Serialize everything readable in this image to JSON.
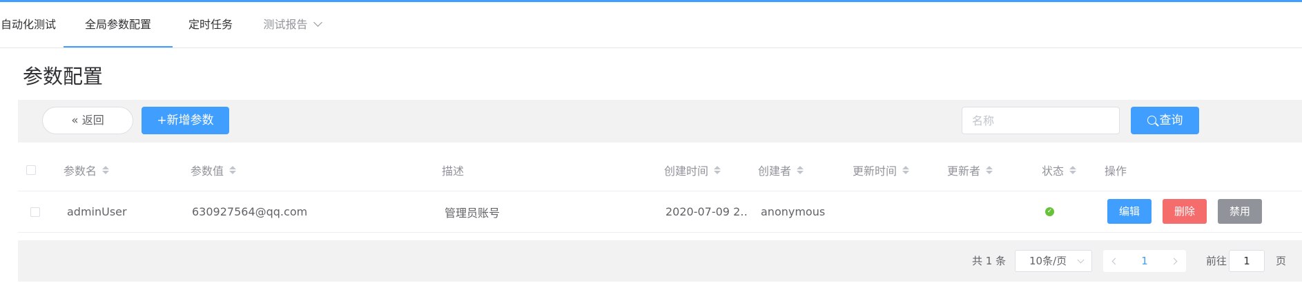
{
  "nav": {
    "items": [
      {
        "label": "自动化测试",
        "active": false
      },
      {
        "label": "全局参数配置",
        "active": true
      },
      {
        "label": "定时任务",
        "active": false
      },
      {
        "label": "测试报告",
        "active": false,
        "has_dropdown": true
      }
    ]
  },
  "page": {
    "title": "参数配置"
  },
  "toolbar": {
    "back_label": "返回",
    "back_icon": "double-chevron-left-icon",
    "add_label": "+新增参数",
    "search_placeholder": "名称",
    "search_value": "",
    "query_label": "查询",
    "query_icon": "search-icon"
  },
  "table": {
    "columns": [
      "参数名",
      "参数值",
      "描述",
      "创建时间",
      "创建者",
      "更新时间",
      "更新者",
      "状态",
      "操作"
    ],
    "rows": [
      {
        "name": "adminUser",
        "value": "630927564@qq.com",
        "description": "管理员账号",
        "created_time": "2020-07-09 2…",
        "creator": "anonymous",
        "updated_time": "",
        "updater": "",
        "status": "enabled",
        "actions": {
          "edit": "编辑",
          "delete": "删除",
          "disable": "禁用"
        }
      }
    ]
  },
  "pagination": {
    "total_text": "共 1 条",
    "page_size": "10条/页",
    "current_page": "1",
    "goto_prefix": "前往",
    "goto_value": "1",
    "goto_suffix": "页"
  },
  "colors": {
    "primary": "#409eff",
    "danger": "#f56c6c",
    "info": "#909399",
    "success": "#67c23a",
    "toolbar_bg": "#f2f2f2"
  }
}
